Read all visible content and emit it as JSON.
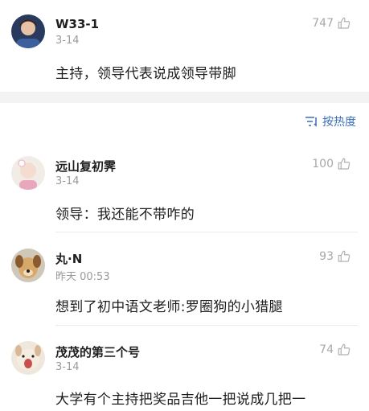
{
  "comments": [
    {
      "username": "W33-1",
      "timestamp": "3-14",
      "content": "主持，领导代表说成领导带脚",
      "likes": "747"
    },
    {
      "username": "远山复初霁",
      "timestamp": "3-14",
      "content": "领导：我还能不带咋的",
      "likes": "100"
    },
    {
      "username": "丸·N",
      "timestamp": "昨天 00:53",
      "content": "想到了初中语文老师:罗圈狗的小猎腿",
      "likes": "93"
    },
    {
      "username": "茂茂的第三个号",
      "timestamp": "3-14",
      "content": "大学有个主持把奖品吉他一把说成几把一",
      "likes": "74"
    }
  ],
  "sort": {
    "label": "按热度"
  },
  "colors": {
    "accent": "#3a6db5",
    "muted": "#9a9a9a",
    "band": "#f3f3f3"
  }
}
